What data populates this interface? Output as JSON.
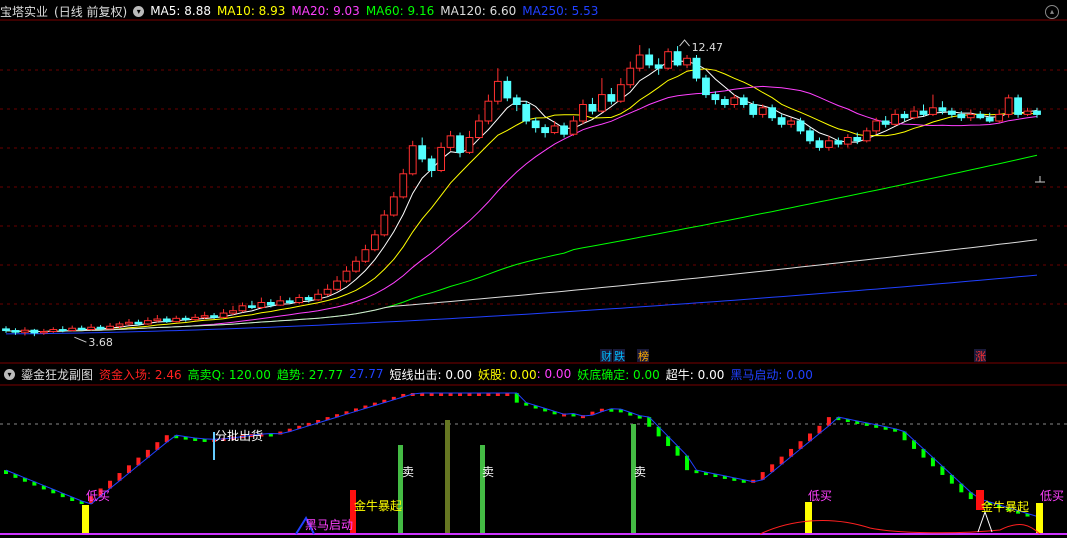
{
  "stock": {
    "name": "宝塔实业",
    "mode": "(日线 前复权)",
    "ma": [
      {
        "label": "MA5: 8.88",
        "color": "#ffffff"
      },
      {
        "label": "MA10: 8.93",
        "color": "#ffff00"
      },
      {
        "label": "MA20: 9.03",
        "color": "#ff40ff"
      },
      {
        "label": "MA60: 9.16",
        "color": "#00ff00"
      },
      {
        "label": "MA120: 6.60",
        "color": "#dddddd"
      },
      {
        "label": "MA250: 5.53",
        "color": "#2040ff"
      }
    ],
    "high_label": "12.47",
    "low_label": "3.68",
    "tags": [
      {
        "text": "财",
        "color": "#00bbff"
      },
      {
        "text": "跌",
        "color": "#00bbff"
      },
      {
        "text": "榜",
        "color": "#ffaa00"
      },
      {
        "text": "涨",
        "color": "#ff3030"
      }
    ]
  },
  "indicator": {
    "name": "鎏金狂龙副图",
    "values": [
      {
        "label": "资金入场: 2.46",
        "color": "#ff2020"
      },
      {
        "label": "高卖Q: 120.00",
        "color": "#00ff00"
      },
      {
        "label": "趋势: 27.77",
        "color": "#00ff00"
      },
      {
        "label": "27.77",
        "color": "#2040ff"
      },
      {
        "label": "短线出击: 0.00",
        "color": "#ffffff"
      },
      {
        "label": "妖股: 0.00",
        "color": "#ffff00"
      },
      {
        "label": ": 0.00",
        "color": "#ff40ff"
      },
      {
        "label": "妖底确定: 0.00",
        "color": "#00ff00"
      },
      {
        "label": "超牛: 0.00",
        "color": "#ffffff"
      },
      {
        "label": "黑马启动: 0.00",
        "color": "#2040ff"
      }
    ],
    "annotations": [
      {
        "text": "分批出货",
        "color": "#ffffff"
      },
      {
        "text": "低买",
        "color": "#ff40ff"
      },
      {
        "text": "黑马启动",
        "color": "#ff40ff"
      },
      {
        "text": "金牛暴起",
        "color": "#ffff00"
      },
      {
        "text": "卖",
        "color": "#ffffff"
      },
      {
        "text": "卖",
        "color": "#ffffff"
      },
      {
        "text": "卖",
        "color": "#ffffff"
      },
      {
        "text": "低买",
        "color": "#ff40ff"
      },
      {
        "text": "金牛暴起",
        "color": "#ffff00"
      },
      {
        "text": "低买",
        "color": "#ff40ff"
      }
    ]
  },
  "chart_data": {
    "type": "candlestick",
    "title": "宝塔实业 (日线 前复权)",
    "price_range": [
      3.2,
      13.2
    ],
    "candles": [
      [
        3.9,
        3.85,
        3.98,
        3.78
      ],
      [
        3.85,
        3.8,
        3.92,
        3.72
      ],
      [
        3.8,
        3.86,
        3.95,
        3.7
      ],
      [
        3.86,
        3.78,
        3.9,
        3.68
      ],
      [
        3.78,
        3.82,
        3.9,
        3.72
      ],
      [
        3.82,
        3.88,
        3.95,
        3.78
      ],
      [
        3.88,
        3.85,
        3.98,
        3.8
      ],
      [
        3.85,
        3.92,
        4.0,
        3.82
      ],
      [
        3.92,
        3.88,
        4.0,
        3.85
      ],
      [
        3.88,
        3.95,
        4.05,
        3.85
      ],
      [
        3.95,
        3.9,
        4.02,
        3.86
      ],
      [
        3.9,
        3.98,
        4.08,
        3.88
      ],
      [
        3.98,
        4.05,
        4.12,
        3.92
      ],
      [
        4.05,
        4.1,
        4.2,
        4.0
      ],
      [
        4.1,
        4.05,
        4.18,
        4.0
      ],
      [
        4.05,
        4.15,
        4.25,
        4.02
      ],
      [
        4.15,
        4.2,
        4.32,
        4.1
      ],
      [
        4.2,
        4.12,
        4.28,
        4.08
      ],
      [
        4.12,
        4.22,
        4.3,
        4.1
      ],
      [
        4.22,
        4.18,
        4.3,
        4.12
      ],
      [
        4.18,
        4.25,
        4.35,
        4.15
      ],
      [
        4.25,
        4.3,
        4.42,
        4.2
      ],
      [
        4.3,
        4.25,
        4.38,
        4.2
      ],
      [
        4.25,
        4.38,
        4.5,
        4.22
      ],
      [
        4.38,
        4.45,
        4.6,
        4.32
      ],
      [
        4.45,
        4.6,
        4.7,
        4.4
      ],
      [
        4.6,
        4.55,
        4.75,
        4.5
      ],
      [
        4.55,
        4.7,
        4.85,
        4.5
      ],
      [
        4.7,
        4.62,
        4.8,
        4.55
      ],
      [
        4.62,
        4.75,
        4.9,
        4.6
      ],
      [
        4.75,
        4.7,
        4.85,
        4.65
      ],
      [
        4.7,
        4.85,
        4.95,
        4.65
      ],
      [
        4.85,
        4.78,
        4.92,
        4.7
      ],
      [
        4.78,
        4.95,
        5.1,
        4.75
      ],
      [
        4.95,
        5.1,
        5.25,
        4.9
      ],
      [
        5.1,
        5.35,
        5.5,
        5.05
      ],
      [
        5.35,
        5.65,
        5.8,
        5.3
      ],
      [
        5.65,
        5.95,
        6.1,
        5.6
      ],
      [
        5.95,
        6.3,
        6.45,
        5.9
      ],
      [
        6.3,
        6.75,
        6.9,
        6.25
      ],
      [
        6.75,
        7.35,
        7.5,
        6.7
      ],
      [
        7.35,
        7.9,
        8.05,
        7.3
      ],
      [
        7.9,
        8.6,
        8.75,
        7.85
      ],
      [
        8.6,
        9.45,
        9.6,
        8.55
      ],
      [
        9.45,
        9.05,
        9.7,
        8.95
      ],
      [
        9.05,
        8.7,
        9.15,
        8.5
      ],
      [
        8.7,
        9.4,
        9.55,
        8.65
      ],
      [
        9.4,
        9.75,
        9.9,
        9.3
      ],
      [
        9.75,
        9.25,
        9.85,
        9.1
      ],
      [
        9.25,
        9.7,
        9.9,
        9.2
      ],
      [
        9.7,
        10.2,
        10.4,
        9.65
      ],
      [
        10.2,
        10.8,
        11.0,
        10.1
      ],
      [
        10.8,
        11.4,
        11.8,
        10.7
      ],
      [
        11.4,
        10.9,
        11.55,
        10.8
      ],
      [
        10.9,
        10.7,
        11.0,
        10.5
      ],
      [
        10.7,
        10.2,
        10.8,
        10.1
      ],
      [
        10.2,
        10.0,
        10.3,
        9.85
      ],
      [
        10.0,
        9.85,
        10.1,
        9.7
      ],
      [
        9.85,
        10.05,
        10.2,
        9.8
      ],
      [
        10.05,
        9.8,
        10.15,
        9.7
      ],
      [
        9.8,
        10.2,
        10.35,
        9.75
      ],
      [
        10.2,
        10.7,
        10.85,
        10.1
      ],
      [
        10.7,
        10.5,
        10.9,
        10.4
      ],
      [
        10.5,
        11.0,
        11.5,
        10.45
      ],
      [
        11.0,
        10.8,
        11.2,
        10.7
      ],
      [
        10.8,
        11.3,
        11.5,
        10.75
      ],
      [
        11.3,
        11.8,
        12.0,
        11.2
      ],
      [
        11.8,
        12.2,
        12.5,
        11.7
      ],
      [
        12.2,
        11.9,
        12.4,
        11.8
      ],
      [
        11.9,
        11.8,
        12.1,
        11.6
      ],
      [
        11.8,
        12.3,
        12.4,
        11.75
      ],
      [
        12.3,
        11.9,
        12.47,
        11.85
      ],
      [
        11.9,
        12.1,
        12.2,
        11.8
      ],
      [
        12.1,
        11.5,
        12.2,
        11.4
      ],
      [
        11.5,
        11.0,
        11.6,
        10.9
      ],
      [
        11.0,
        10.85,
        11.1,
        10.7
      ],
      [
        10.85,
        10.7,
        10.95,
        10.6
      ],
      [
        10.7,
        10.9,
        11.0,
        10.6
      ],
      [
        10.9,
        10.7,
        11.0,
        10.6
      ],
      [
        10.7,
        10.4,
        10.8,
        10.3
      ],
      [
        10.4,
        10.6,
        10.7,
        10.3
      ],
      [
        10.6,
        10.3,
        10.7,
        10.2
      ],
      [
        10.3,
        10.1,
        10.4,
        10.0
      ],
      [
        10.1,
        10.2,
        10.3,
        10.0
      ],
      [
        10.2,
        9.9,
        10.3,
        9.8
      ],
      [
        9.9,
        9.6,
        10.0,
        9.5
      ],
      [
        9.6,
        9.4,
        9.7,
        9.3
      ],
      [
        9.4,
        9.6,
        9.75,
        9.3
      ],
      [
        9.6,
        9.5,
        9.7,
        9.4
      ],
      [
        9.5,
        9.7,
        9.8,
        9.4
      ],
      [
        9.7,
        9.6,
        9.85,
        9.5
      ],
      [
        9.6,
        9.9,
        10.0,
        9.55
      ],
      [
        9.9,
        10.2,
        10.3,
        9.8
      ],
      [
        10.2,
        10.1,
        10.35,
        10.0
      ],
      [
        10.1,
        10.4,
        10.55,
        10.05
      ],
      [
        10.4,
        10.3,
        10.5,
        10.2
      ],
      [
        10.3,
        10.5,
        10.65,
        10.25
      ],
      [
        10.5,
        10.4,
        10.7,
        10.35
      ],
      [
        10.4,
        10.6,
        11.0,
        10.35
      ],
      [
        10.6,
        10.5,
        10.8,
        10.4
      ],
      [
        10.5,
        10.4,
        10.6,
        10.3
      ],
      [
        10.4,
        10.3,
        10.5,
        10.2
      ],
      [
        10.3,
        10.4,
        10.55,
        10.2
      ],
      [
        10.4,
        10.3,
        10.5,
        10.25
      ],
      [
        10.3,
        10.2,
        10.45,
        10.15
      ],
      [
        10.2,
        10.4,
        10.55,
        10.15
      ],
      [
        10.4,
        10.9,
        11.0,
        10.3
      ],
      [
        10.9,
        10.4,
        11.0,
        10.3
      ],
      [
        10.4,
        10.5,
        10.6,
        10.35
      ],
      [
        10.5,
        10.4,
        10.6,
        10.3
      ]
    ],
    "ma_series": [
      {
        "name": "MA5",
        "color": "#ffffff",
        "period": 5
      },
      {
        "name": "MA10",
        "color": "#ffff00",
        "period": 10
      },
      {
        "name": "MA20",
        "color": "#ff40ff",
        "period": 20
      },
      {
        "name": "MA60",
        "color": "#00ff00",
        "period": 60
      },
      {
        "name": "MA120",
        "color": "#dddddd",
        "period": 120
      },
      {
        "name": "MA250",
        "color": "#2040ff",
        "period": 250
      }
    ]
  }
}
